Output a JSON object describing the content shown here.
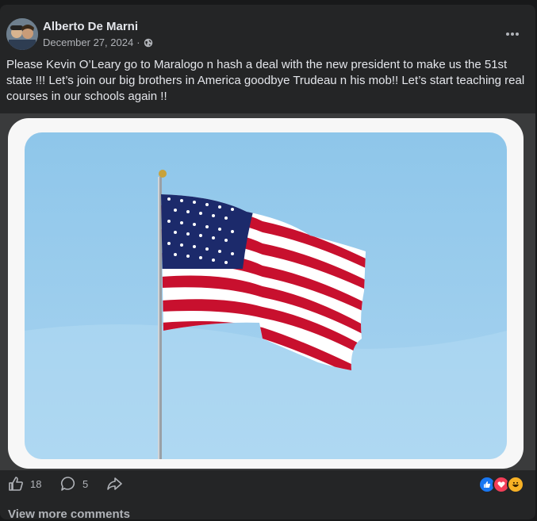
{
  "post": {
    "author": "Alberto De Marni",
    "date": "December 27, 2024",
    "privacy_icon": "globe-icon",
    "text": "Please Kevin O’Leary go to Maralogo n hash a deal with the new president to make us the 51st state !!! Let’s join our big brothers in America goodbye Trudeau n his mob!! Let’s start teaching real courses in our schools again !!",
    "image": "american-flag-photo"
  },
  "actions": {
    "like_count": "18",
    "comment_count": "5",
    "share_icon": "share-icon"
  },
  "reactions": [
    "like-reaction",
    "love-reaction",
    "haha-reaction"
  ],
  "comments": {
    "view_more": "View more comments"
  },
  "colors": {
    "background": "#18191a",
    "card": "#242526",
    "text": "#e4e6eb",
    "secondary": "#b0b3b8",
    "like_blue": "#1877f2",
    "love_red": "#f33e58"
  }
}
